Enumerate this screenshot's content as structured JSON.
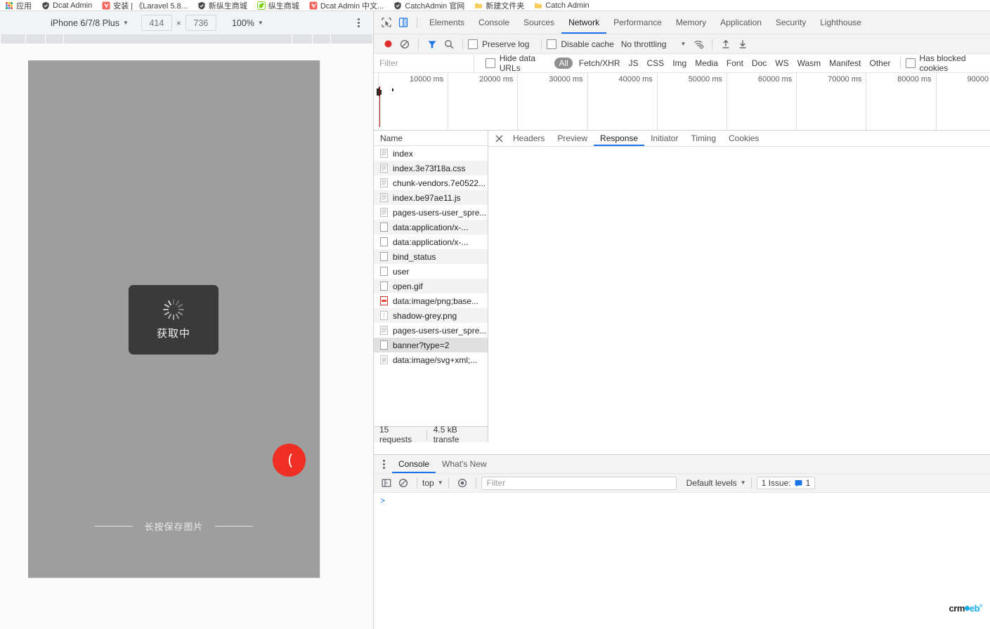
{
  "bookmarks": [
    {
      "label": "应用",
      "icon": "apps-icon"
    },
    {
      "label": "Dcat Admin",
      "icon": "shield-icon"
    },
    {
      "label": "安装 | 《Laravel 5.8...",
      "icon": "laravel-icon"
    },
    {
      "label": "新纵生商城",
      "icon": "shield-icon"
    },
    {
      "label": "纵生商城",
      "icon": "leaf-icon"
    },
    {
      "label": "Dcat Admin 中文...",
      "icon": "laravel-icon"
    },
    {
      "label": "CatchAdmin 官网",
      "icon": "shield-icon"
    },
    {
      "label": "新建文件夹",
      "icon": "folder-icon"
    },
    {
      "label": "Catch Admin",
      "icon": "folder-icon"
    }
  ],
  "device_toolbar": {
    "device": "iPhone 6/7/8 Plus",
    "width": "414",
    "height": "736",
    "x_separator": "×",
    "zoom": "100%",
    "more_options": "more-options"
  },
  "phone": {
    "loading_text": "获取中",
    "save_hint": "长按保存图片",
    "fab_label": "back-arrow"
  },
  "devtools": {
    "tabs": [
      {
        "label": "Elements",
        "active": false
      },
      {
        "label": "Console",
        "active": false
      },
      {
        "label": "Sources",
        "active": false
      },
      {
        "label": "Network",
        "active": true
      },
      {
        "label": "Performance",
        "active": false
      },
      {
        "label": "Memory",
        "active": false
      },
      {
        "label": "Application",
        "active": false
      },
      {
        "label": "Security",
        "active": false
      },
      {
        "label": "Lighthouse",
        "active": false
      }
    ],
    "toolbar": {
      "record_icon": "record-icon",
      "clear_icon": "clear-icon",
      "filter_icon": "filter-icon",
      "search_icon": "search-icon",
      "preserve_log": "Preserve log",
      "disable_cache": "Disable cache",
      "throttling": "No throttling",
      "wifi_icon": "network-conditions-icon",
      "import_icon": "import-har-icon",
      "export_icon": "export-har-icon"
    },
    "filterbar": {
      "filter_placeholder": "Filter",
      "hide_data_urls": "Hide data URLs",
      "types": [
        "All",
        "Fetch/XHR",
        "JS",
        "CSS",
        "Img",
        "Media",
        "Font",
        "Doc",
        "WS",
        "Wasm",
        "Manifest",
        "Other"
      ],
      "active_type": "All",
      "has_blocked_cookies": "Has blocked cookies"
    },
    "overview": {
      "ticks": [
        "10000 ms",
        "20000 ms",
        "30000 ms",
        "40000 ms",
        "50000 ms",
        "60000 ms",
        "70000 ms",
        "80000 ms",
        "90000 ms"
      ]
    },
    "requests": {
      "column_header": "Name",
      "rows": [
        {
          "name": "index",
          "icon": "document-icon"
        },
        {
          "name": "index.3e73f18a.css",
          "icon": "document-icon"
        },
        {
          "name": "chunk-vendors.7e0522...",
          "icon": "document-icon"
        },
        {
          "name": "index.be97ae11.js",
          "icon": "document-icon"
        },
        {
          "name": "pages-users-user_spre...",
          "icon": "document-icon"
        },
        {
          "name": "data:application/x-...",
          "icon": "generic-icon"
        },
        {
          "name": "data:application/x-...",
          "icon": "generic-icon"
        },
        {
          "name": "bind_status",
          "icon": "generic-icon"
        },
        {
          "name": "user",
          "icon": "generic-icon"
        },
        {
          "name": "open.gif",
          "icon": "generic-icon"
        },
        {
          "name": "data:image/png;base...",
          "icon": "image-error-icon"
        },
        {
          "name": "shadow-grey.png",
          "icon": "image-icon"
        },
        {
          "name": "pages-users-user_spre...",
          "icon": "document-icon"
        },
        {
          "name": "banner?type=2",
          "icon": "generic-icon",
          "selected": true
        },
        {
          "name": "data:image/svg+xml;...",
          "icon": "svg-icon"
        }
      ],
      "footer": {
        "requests": "15 requests",
        "transferred": "4.5 kB transfe"
      }
    },
    "detail_tabs": [
      {
        "label": "Headers",
        "active": false
      },
      {
        "label": "Preview",
        "active": false
      },
      {
        "label": "Response",
        "active": true
      },
      {
        "label": "Initiator",
        "active": false
      },
      {
        "label": "Timing",
        "active": false
      },
      {
        "label": "Cookies",
        "active": false
      }
    ],
    "detail_close": "close-icon",
    "drawer": {
      "menu_icon": "drawer-menu-icon",
      "tabs": [
        {
          "label": "Console",
          "active": true
        },
        {
          "label": "What's New",
          "active": false
        }
      ],
      "console_toolbar": {
        "sidebar_icon": "console-sidebar-icon",
        "clear_icon": "clear-console-icon",
        "context": "top",
        "eye_icon": "live-expression-icon",
        "filter_placeholder": "Filter",
        "levels": "Default levels",
        "issues": "1 Issue:",
        "issues_count": "1"
      },
      "prompt": ">"
    }
  },
  "watermark": {
    "part1": "crm",
    "part2": "eb"
  },
  "colors": {
    "accent": "#1a73e8",
    "record": "#dd2c2c",
    "fab": "#ef2f23",
    "phone_bg": "#9e9e9e",
    "loading_box": "#3a3a3a",
    "watermark_blue": "#14a9e8"
  }
}
